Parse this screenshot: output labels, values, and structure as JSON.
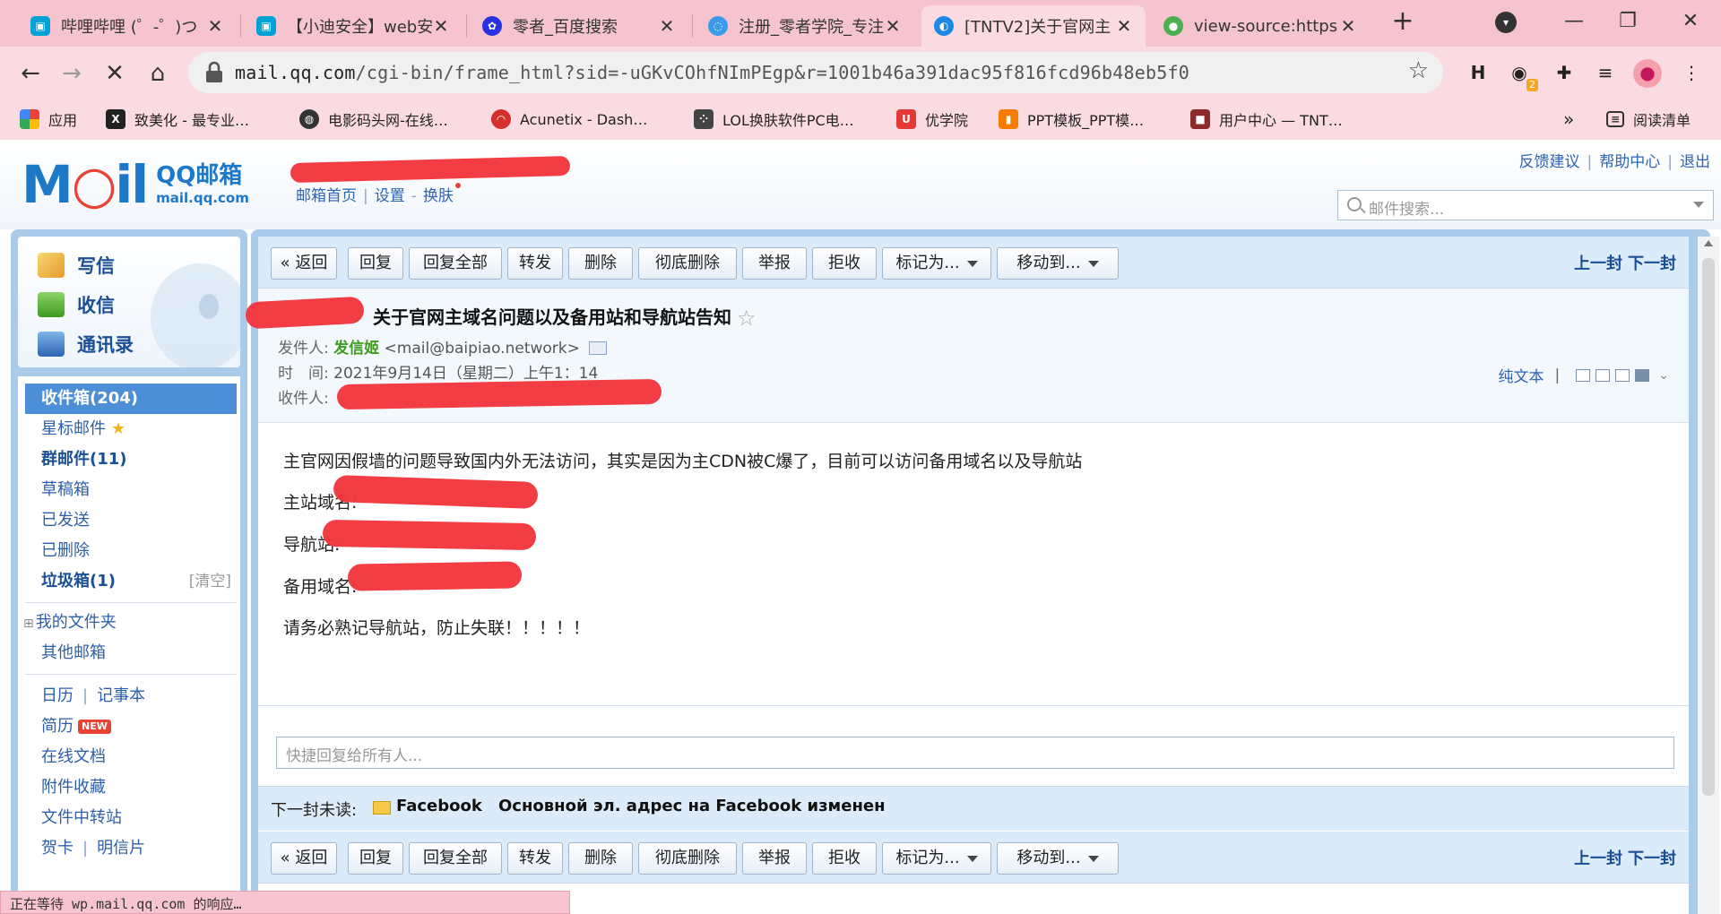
{
  "browser": {
    "tabs": [
      {
        "title": "哔哩哔哩 (゜-゜)つ"
      },
      {
        "title": "【小迪安全】web安"
      },
      {
        "title": "零者_百度搜索"
      },
      {
        "title": "注册_零者学院_专注"
      },
      {
        "title": "[TNTV2]关于官网主"
      },
      {
        "title": "view-source:https"
      }
    ],
    "url_host": "mail.qq.com",
    "url_path": "/cgi-bin/frame_html?sid=-uGKvCOhfNImPEgp&r=1001b46a391dac95f816fcd96b48eb5f0",
    "ext_badge": "2",
    "bookmarks": [
      "应用",
      "致美化 - 最专业…",
      "电影码头网-在线…",
      "Acunetix - Dash…",
      "LOL换肤软件PC电…",
      "优学院",
      "PPT模板_PPT模…",
      "用户中心 — TNT…"
    ],
    "more_bookmarks": "»",
    "reading_list": "阅读清单",
    "status": "正在等待 wp.mail.qq.com 的响应…"
  },
  "header": {
    "logo_qq": "QQ邮箱",
    "logo_domain": "mail.qq.com",
    "links": [
      "邮箱首页",
      "设置",
      "换肤"
    ],
    "right_links": [
      "反馈建议",
      "帮助中心",
      "退出"
    ],
    "search_placeholder": "邮件搜索..."
  },
  "sidebar": {
    "actions": [
      "写信",
      "收信",
      "通讯录"
    ],
    "inbox": "收件箱(204)",
    "starred": "星标邮件",
    "group": "群邮件(11)",
    "drafts": "草稿箱",
    "sent": "已发送",
    "deleted": "已删除",
    "spam": "垃圾箱(1)",
    "spam_clear": "[清空]",
    "my_folders": "我的文件夹",
    "other_mail": "其他邮箱",
    "calendar": "日历",
    "notes": "记事本",
    "resume": "简历",
    "resume_badge": "NEW",
    "docs": "在线文档",
    "attachments": "附件收藏",
    "transfer": "文件中转站",
    "cards": "贺卡",
    "postcards": "明信片"
  },
  "toolbar": {
    "back": "« 返回",
    "reply": "回复",
    "reply_all": "回复全部",
    "forward": "转发",
    "delete": "删除",
    "perm_delete": "彻底删除",
    "report": "举报",
    "reject": "拒收",
    "mark_as": "标记为...",
    "move_to": "移动到...",
    "prev": "上一封",
    "next": "下一封"
  },
  "mail": {
    "subject": "关于官网主域名问题以及备用站和导航站告知",
    "from_label": "发件人:",
    "sender_name": "发信姬",
    "sender_addr": "<mail@baipiao.network>",
    "time_label": "时　间:",
    "time": "2021年9月14日（星期二）上午1：14",
    "to_label": "收件人:",
    "plain_text": "纯文本",
    "body": [
      "主官网因假墙的问题导致国内外无法访问，其实是因为主CDN被C爆了，目前可以访问备用域名以及导航站",
      "主站域名:",
      "导航站:",
      "备用域名:",
      "请务必熟记导航站，防止失联！！！！！"
    ],
    "quick_reply_placeholder": "快捷回复给所有人...",
    "next_unread_label": "下一封未读:",
    "next_unread_from": "Facebook",
    "next_unread_subject": "Основной эл. адрес на Facebook изменен"
  },
  "colors": {
    "tab_bg": "#f5c4cf",
    "toolbar_bg": "#fbdbe2",
    "frame_blue": "#aacbe9",
    "link_blue": "#2d64b3",
    "sender_green": "#3d9b1f",
    "redaction": "#f2353c"
  }
}
